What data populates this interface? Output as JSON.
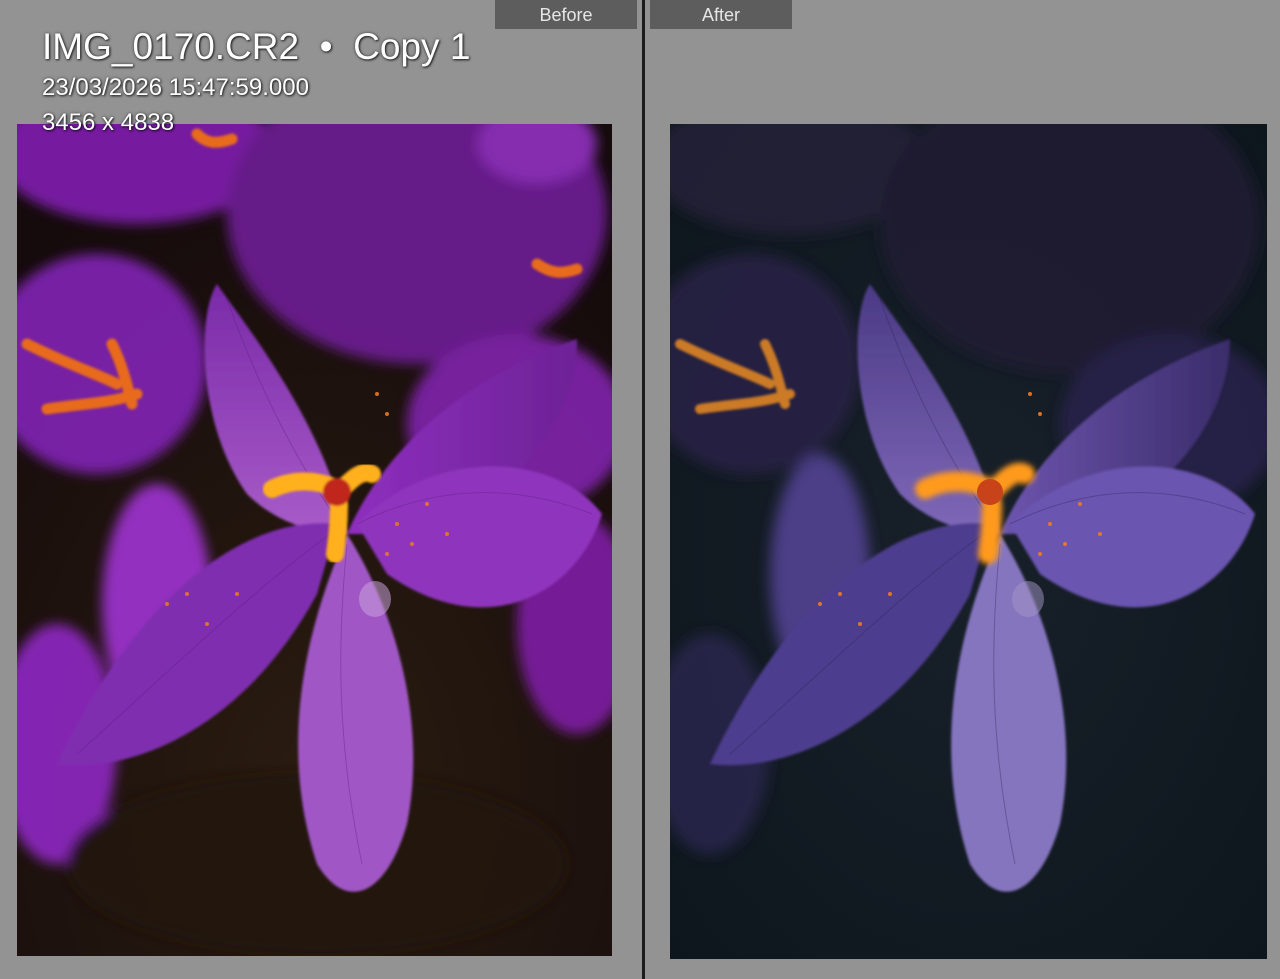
{
  "compare": {
    "before_label": "Before",
    "after_label": "After"
  },
  "info_overlay": {
    "filename": "IMG_0170.CR2",
    "separator": "•",
    "copy_name": "Copy 1",
    "capture_datetime": "23/03/2026 15:47:59.000",
    "dimensions": "3456 x 4838"
  },
  "colors": {
    "panel_background": "#939393",
    "tab_background": "#5d5d5d",
    "divider": "#1c1c1c",
    "before_petal": "#8a2bb8",
    "after_petal": "#6a4fb0",
    "after_background": "#101a20",
    "stamen": "#ff9a1a"
  }
}
